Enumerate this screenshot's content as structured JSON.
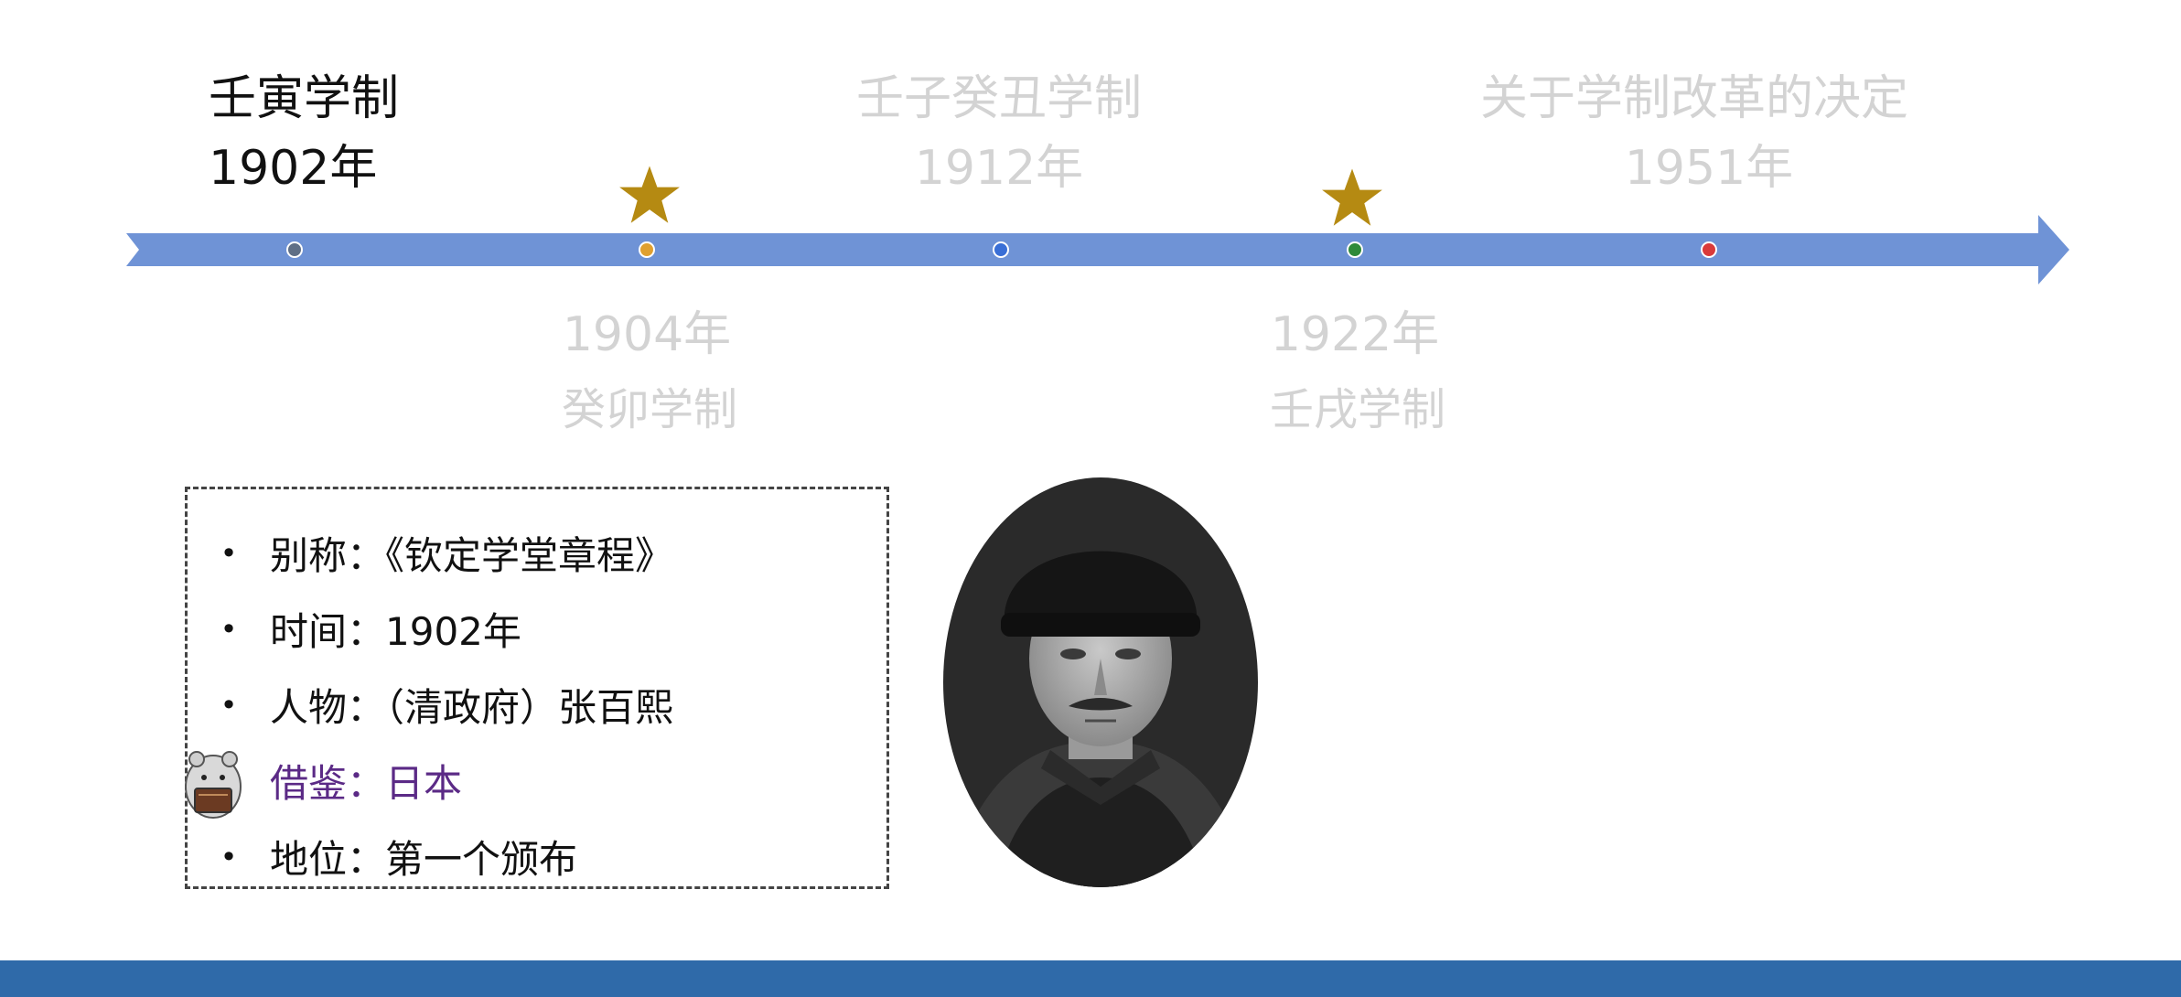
{
  "timeline": {
    "above": [
      {
        "name": "壬寅学制",
        "year": "1902年"
      },
      {
        "name": "壬子癸丑学制",
        "year": "1912年"
      },
      {
        "name": "关于学制改革的决定",
        "year": "1951年"
      }
    ],
    "below": [
      {
        "year": "1904年",
        "name": "癸卯学制"
      },
      {
        "year": "1922年",
        "name": "壬戌学制"
      }
    ],
    "colors": {
      "arrow": "#6f93d6",
      "dot_1902": "#5f6f86",
      "dot_1904": "#e0a030",
      "dot_1912": "#3a6fd6",
      "dot_1922": "#2f8a3a",
      "dot_1951": "#d93a3a",
      "star": "#b58a12"
    }
  },
  "info": {
    "items": [
      {
        "text": "别称：《钦定学堂章程》"
      },
      {
        "text": "时间：1902年"
      },
      {
        "text": "人物：（清政府）张百熙"
      },
      {
        "text": "借鉴：日本"
      },
      {
        "text": "地位：第一个颁布"
      }
    ],
    "bullet": "•"
  }
}
